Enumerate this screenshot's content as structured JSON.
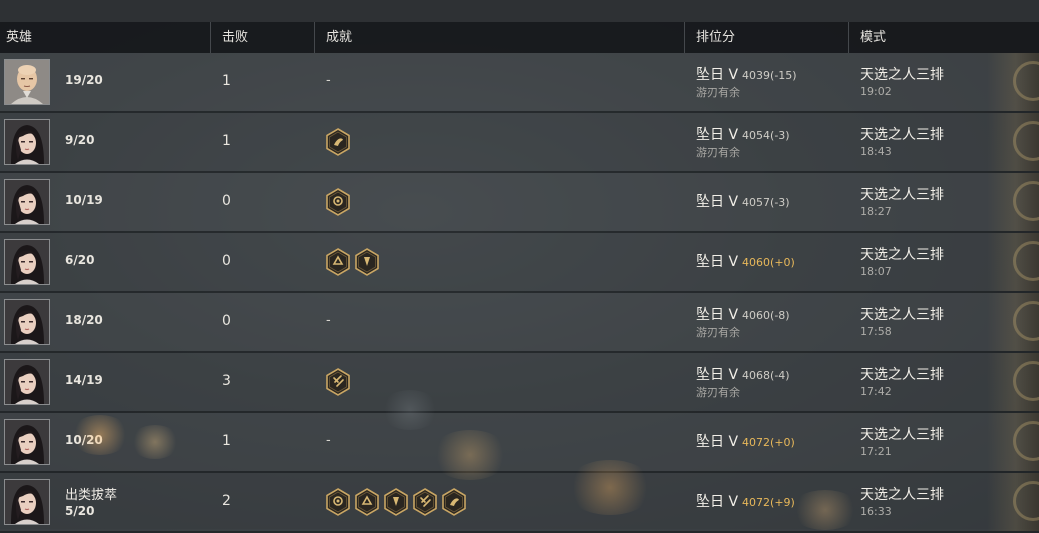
{
  "header": {
    "hero": "英雄",
    "kills": "击败",
    "achievements": "成就",
    "rank": "排位分",
    "mode": "模式"
  },
  "rows": [
    {
      "title": "",
      "score": "19/20",
      "kills": "1",
      "ach_text": "-",
      "achievements": [],
      "tier": "坠日 V",
      "rank_score": "4039(-15)",
      "rank_sub": "游刃有余",
      "mode": "天选之人三排",
      "time": "19:02",
      "avatar": "bald-hero-avatar"
    },
    {
      "title": "",
      "score": "9/20",
      "kills": "1",
      "ach_text": "",
      "achievements": [
        "achievement-badge"
      ],
      "tier": "坠日 V",
      "rank_score": "4054(-3)",
      "rank_sub": "游刃有余",
      "mode": "天选之人三排",
      "time": "18:43",
      "avatar": "female-hero-avatar"
    },
    {
      "title": "",
      "score": "10/19",
      "kills": "0",
      "ach_text": "",
      "achievements": [
        "achievement-badge"
      ],
      "tier": "坠日 V",
      "rank_score": "4057(-3)",
      "rank_sub": "",
      "mode": "天选之人三排",
      "time": "18:27",
      "avatar": "female-hero-avatar"
    },
    {
      "title": "",
      "score": "6/20",
      "kills": "0",
      "ach_text": "",
      "achievements": [
        "achievement-badge",
        "achievement-badge"
      ],
      "tier": "坠日 V",
      "rank_score": "4060(+0)",
      "rank_sub": "",
      "mode": "天选之人三排",
      "time": "18:07",
      "avatar": "female-hero-avatar"
    },
    {
      "title": "",
      "score": "18/20",
      "kills": "0",
      "ach_text": "-",
      "achievements": [],
      "tier": "坠日 V",
      "rank_score": "4060(-8)",
      "rank_sub": "游刃有余",
      "mode": "天选之人三排",
      "time": "17:58",
      "avatar": "female-hero-avatar"
    },
    {
      "title": "",
      "score": "14/19",
      "kills": "3",
      "ach_text": "",
      "achievements": [
        "achievement-badge"
      ],
      "tier": "坠日 V",
      "rank_score": "4068(-4)",
      "rank_sub": "游刃有余",
      "mode": "天选之人三排",
      "time": "17:42",
      "avatar": "female-hero-avatar"
    },
    {
      "title": "",
      "score": "10/20",
      "kills": "1",
      "ach_text": "-",
      "achievements": [],
      "tier": "坠日 V",
      "rank_score": "4072(+0)",
      "rank_sub": "",
      "mode": "天选之人三排",
      "time": "17:21",
      "avatar": "female-hero-avatar"
    },
    {
      "title": "出类拔萃",
      "score": "5/20",
      "kills": "2",
      "ach_text": "",
      "achievements": [
        "achievement-badge",
        "achievement-badge",
        "achievement-badge",
        "achievement-badge",
        "achievement-badge"
      ],
      "tier": "坠日 V",
      "rank_score": "4072(+9)",
      "rank_sub": "",
      "mode": "天选之人三排",
      "time": "16:33",
      "avatar": "female-hero-avatar"
    }
  ],
  "colors": {
    "gold_score": "#e8b85a",
    "badge_gold": "#c9a664",
    "header_bg": "#17191c"
  }
}
